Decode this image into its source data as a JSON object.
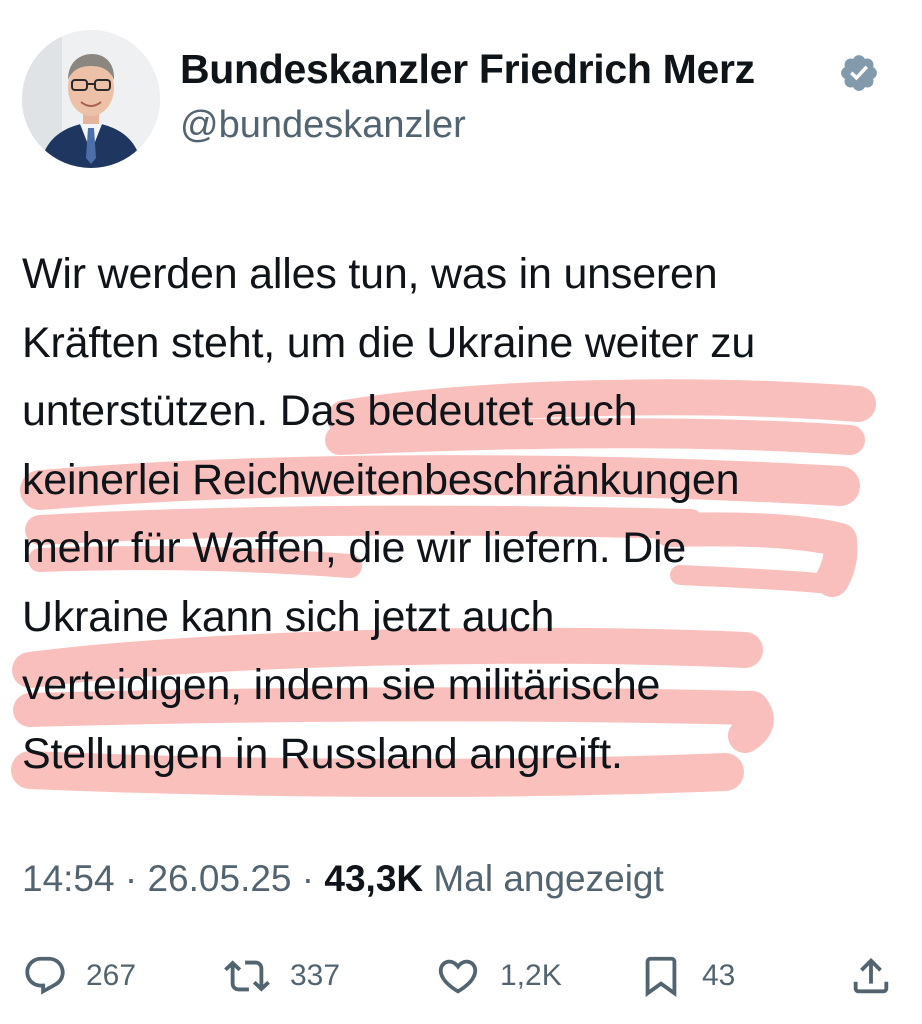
{
  "author": {
    "display_name": "Bundeskanzler Friedrich Merz",
    "handle": "@bundeskanzler",
    "verified": true,
    "avatar_icon": "profile-photo"
  },
  "tweet": {
    "text": "Wir werden alles tun, was in unseren\nKräften steht, um die Ukraine weiter zu\nunterstützen. Das bedeutet auch\nkeinerlei Reichweitenbeschränkungen\nmehr für Waffen, die wir liefern. Die\nUkraine kann sich jetzt auch\nverteidigen, indem sie militärische\nStellungen in Russland angreift.",
    "highlight_color": "#f7a5a0"
  },
  "meta": {
    "time": "14:54",
    "separator": "·",
    "date": "26.05.25",
    "views": "43,3K",
    "views_label": "Mal angezeigt"
  },
  "actions": {
    "reply": {
      "icon": "reply-icon",
      "count": "267"
    },
    "repost": {
      "icon": "repost-icon",
      "count": "337"
    },
    "like": {
      "icon": "heart-icon",
      "count": "1,2K"
    },
    "bookmark": {
      "icon": "bookmark-icon",
      "count": "43"
    },
    "share": {
      "icon": "share-icon"
    }
  },
  "colors": {
    "text": "#0f1419",
    "secondary": "#536471",
    "verified_badge": "#829aab"
  }
}
